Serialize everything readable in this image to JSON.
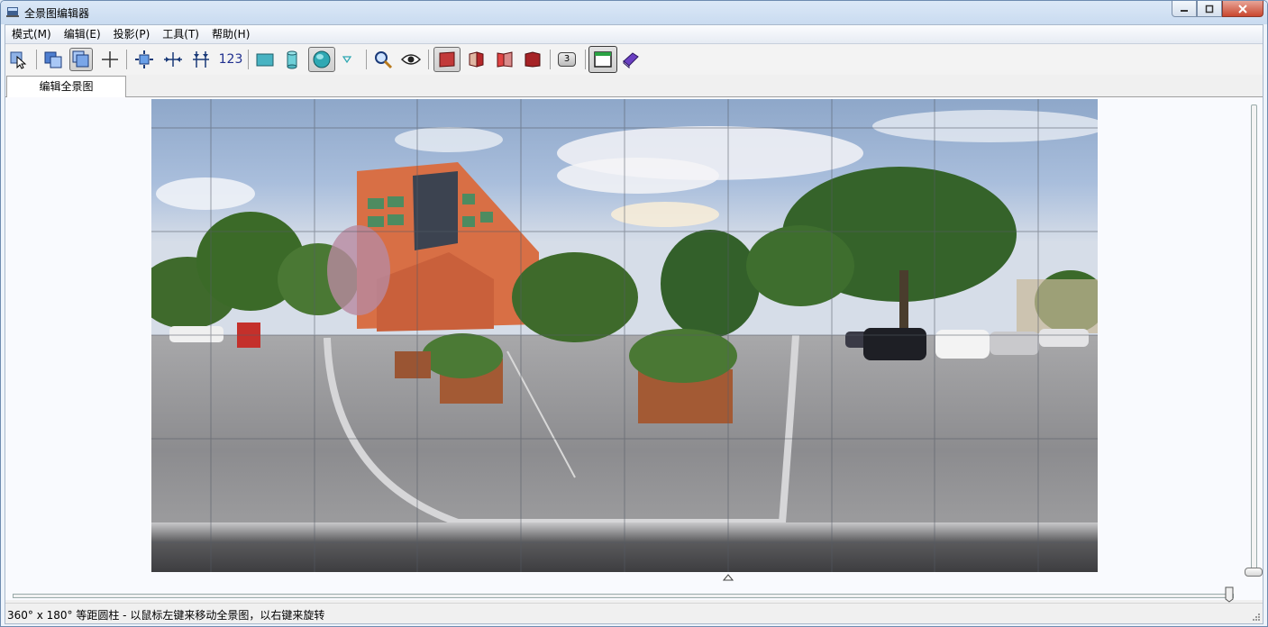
{
  "window": {
    "title": "全景图编辑器"
  },
  "menu": [
    {
      "label": "模式(M)"
    },
    {
      "label": "编辑(E)"
    },
    {
      "label": "投影(P)"
    },
    {
      "label": "工具(T)"
    },
    {
      "label": "帮助(H)"
    }
  ],
  "toolbar": {
    "numbers_label": "123",
    "control_points_label": "3",
    "icons": [
      "select-pointer-icon",
      "drag-move-icon",
      "drag-rotate-icon",
      "crosshair-icon",
      "fit-center-icon",
      "fit-horizontal-icon",
      "fit-vertical-icon",
      "numbers-icon",
      "rectilinear-projection-icon",
      "cylindrical-projection-icon",
      "equirectangular-projection-icon",
      "more-projections-icon",
      "zoom-icon",
      "preview-eye-icon",
      "mask-image-icon",
      "mask-left-icon",
      "mask-right-icon",
      "mask-both-icon",
      "control-points-icon",
      "panorama-window-icon",
      "book-icon"
    ]
  },
  "tabs": [
    {
      "label": "编辑全景图"
    }
  ],
  "viewer": {
    "grid": true,
    "zoom_slider_fraction": 1.0
  },
  "status": {
    "text": "360° x 180° 等距圆柱 - 以鼠标左键来移动全景图，以右键来旋转"
  },
  "colors": {
    "title_bar": "#c9dbf0",
    "sky": "#a9bedc",
    "ground": "#8f8f91",
    "trees": "#3e6a2b",
    "building": "#d86f45"
  }
}
